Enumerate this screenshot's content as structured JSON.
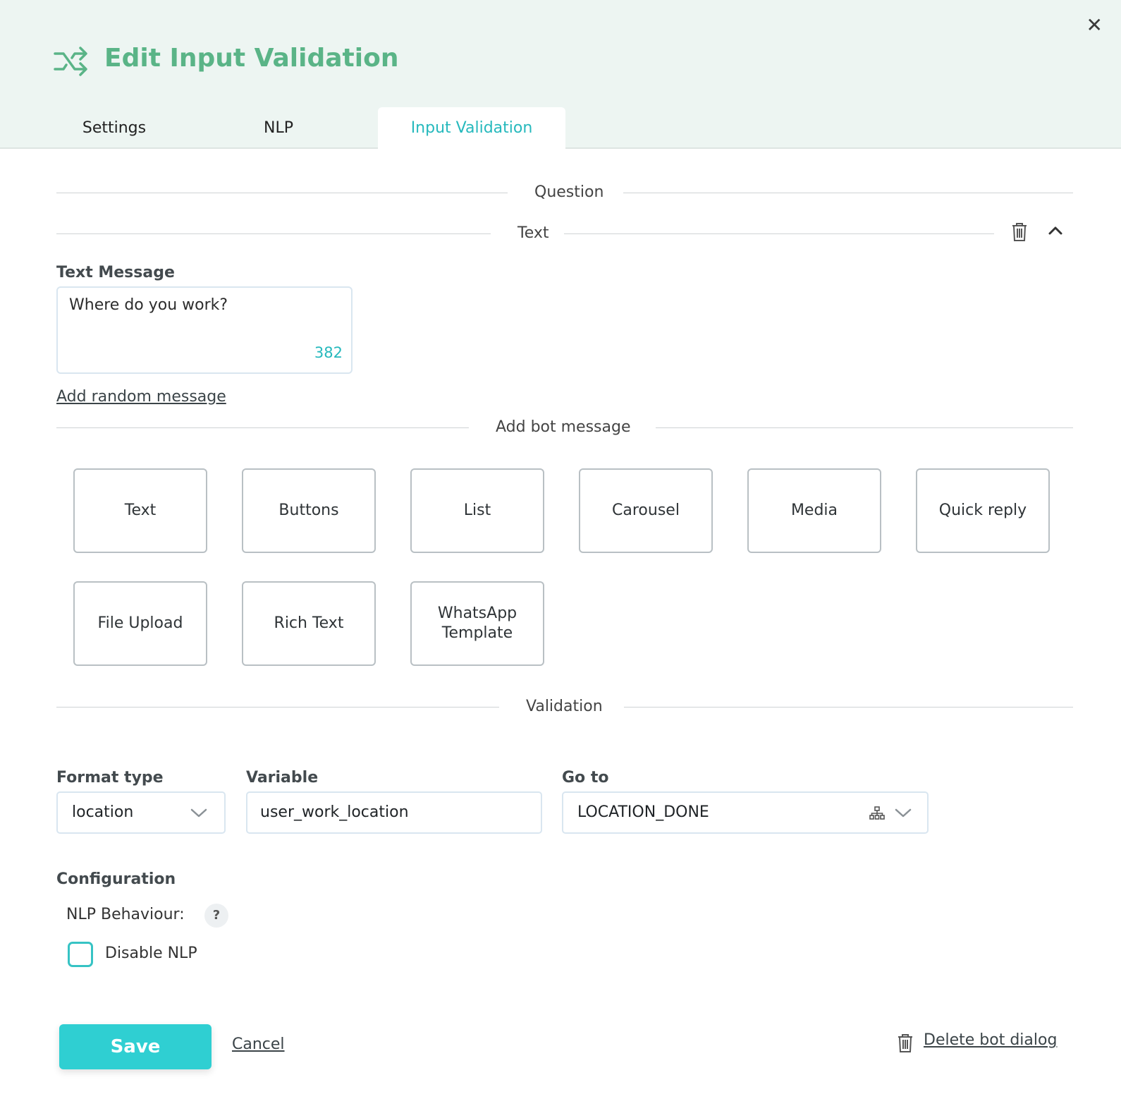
{
  "dialog": {
    "title": "Edit Input Validation",
    "close_icon": "close-icon",
    "title_icon": "shuffle-arrows-icon"
  },
  "tabs": [
    {
      "label": "Settings",
      "active": false
    },
    {
      "label": "NLP",
      "active": false
    },
    {
      "label": "Input Validation",
      "active": true
    }
  ],
  "question": {
    "section_label": "Question",
    "block_label": "Text",
    "text_message_label": "Text Message",
    "text_message_value": "Where do you work?",
    "char_counter": "382",
    "add_random_message": "Add random message"
  },
  "add_bot_message": {
    "section_label": "Add bot message",
    "tiles": [
      "Text",
      "Buttons",
      "List",
      "Carousel",
      "Media",
      "Quick reply",
      "File Upload",
      "Rich Text",
      "WhatsApp Template"
    ]
  },
  "validation": {
    "section_label": "Validation",
    "format_type_label": "Format type",
    "format_type_value": "location",
    "variable_label": "Variable",
    "variable_value": "user_work_location",
    "goto_label": "Go to",
    "goto_value": "LOCATION_DONE"
  },
  "configuration": {
    "label": "Configuration",
    "nlp_behaviour_label": "NLP Behaviour:",
    "help": "?",
    "disable_nlp_label": "Disable NLP",
    "disable_nlp_checked": false
  },
  "footer": {
    "save_label": "Save",
    "cancel_label": "Cancel",
    "delete_label": "Delete bot dialog"
  },
  "colors": {
    "accent_teal": "#2fcfd2",
    "title_green": "#5ab487",
    "header_bg": "#edf5f2"
  }
}
